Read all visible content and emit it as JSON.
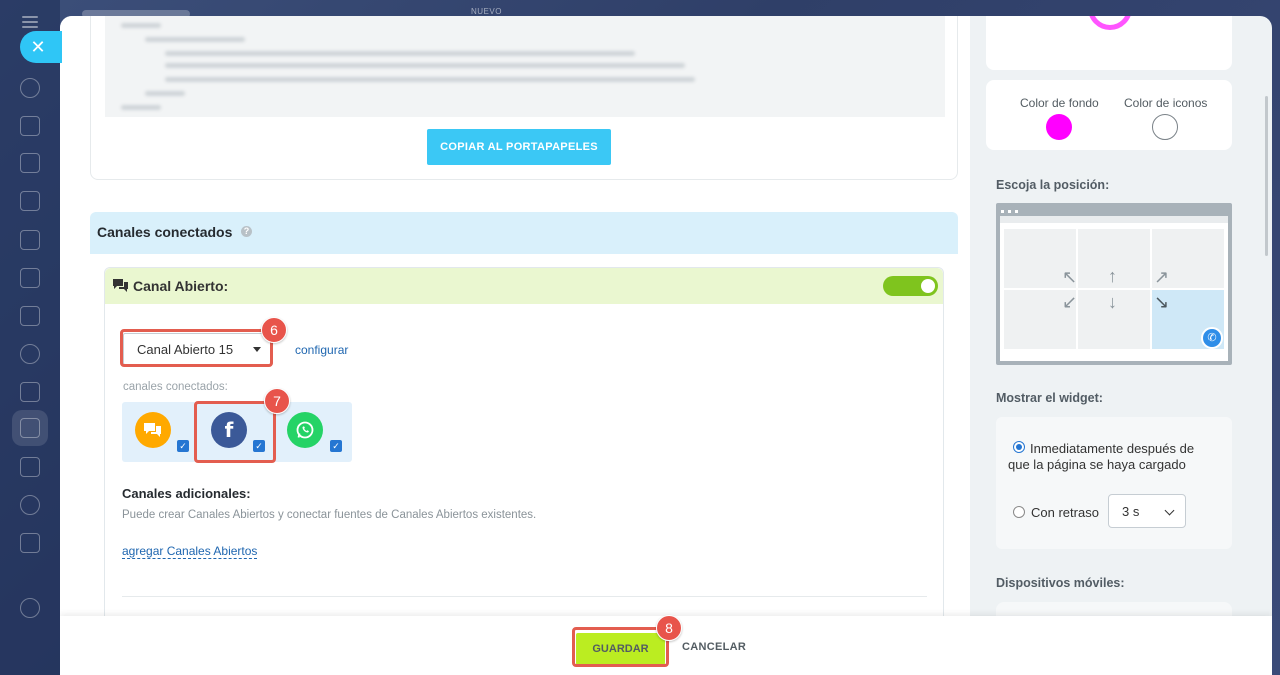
{
  "topbar": {
    "label": "NUEVO"
  },
  "code_section": {
    "copy_button": "COPIAR AL PORTAPAPELES"
  },
  "connected_channels": {
    "title": "Canales conectados",
    "help": "?",
    "open_channel": {
      "icon": "chat-bubbles-icon",
      "title": "Canal Abierto:",
      "enabled": true,
      "selected_channel": "Canal Abierto 15",
      "configure_link": "configurar",
      "connected_label": "canales conectados:",
      "channels": [
        {
          "name": "live-chat",
          "icon": "chat-icon",
          "color": "#ffa900",
          "checked": true
        },
        {
          "name": "facebook",
          "icon": "facebook-icon",
          "glyph": "f",
          "color": "#3b5998",
          "checked": true
        },
        {
          "name": "whatsapp",
          "icon": "whatsapp-icon",
          "color": "#25d366",
          "checked": true
        }
      ],
      "additional_title": "Canales adicionales:",
      "additional_desc": "Puede crear Canales Abiertos y conectar fuentes de Canales Abiertos existentes.",
      "add_link": "agregar Canales Abiertos"
    }
  },
  "side": {
    "bg_color_label": "Color de fondo",
    "icon_color_label": "Color de iconos",
    "bg_color": "#ff00ff",
    "icon_color": "#ffffff",
    "position_label": "Escoja la posición:",
    "position_selected": "bottom-right",
    "show_widget_label": "Mostrar el widget:",
    "show_immediately": "Inmediatamente después de que la página se haya cargado",
    "show_delay": "Con retraso",
    "delay_value": "3 s",
    "mobile_label": "Dispositivos móviles:"
  },
  "footer": {
    "save": "GUARDAR",
    "cancel": "CANCELAR"
  },
  "annotations": [
    "6",
    "7",
    "8"
  ]
}
